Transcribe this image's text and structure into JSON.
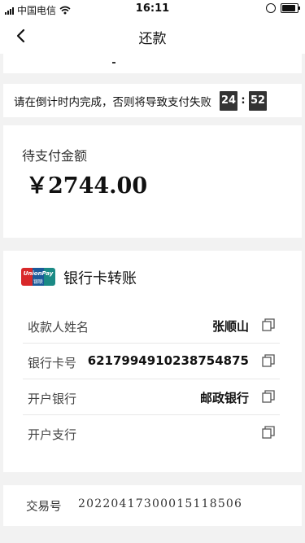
{
  "status_bar": {
    "carrier": "中国电信",
    "time": "16:11"
  },
  "nav": {
    "title": "还款"
  },
  "countdown": {
    "message": "请在倒计时内完成，否则将导致支付失败",
    "minutes": "24",
    "separator": ":",
    "seconds": "52"
  },
  "amount": {
    "label": "待支付金额",
    "value": "￥2744.00"
  },
  "bank_transfer": {
    "title": "银行卡转账",
    "rows": [
      {
        "label": "收款人姓名",
        "value": "张顺山"
      },
      {
        "label": "银行卡号",
        "value": "6217994910238754875"
      },
      {
        "label": "开户银行",
        "value": "邮政银行"
      },
      {
        "label": "开户支行",
        "value": ""
      }
    ]
  },
  "trade": {
    "label": "交易号",
    "value": "20220417300015118506"
  },
  "colors": {
    "background": "#f2f2f2",
    "countdown_box": "#333333",
    "unionpay_red": "#d8282a",
    "unionpay_blue": "#1b5a9a",
    "unionpay_green": "#1b8a85"
  },
  "icons": [
    "back-arrow-icon",
    "wifi-icon",
    "signal-icon",
    "battery-icon",
    "unionpay-logo",
    "copy-icon"
  ]
}
